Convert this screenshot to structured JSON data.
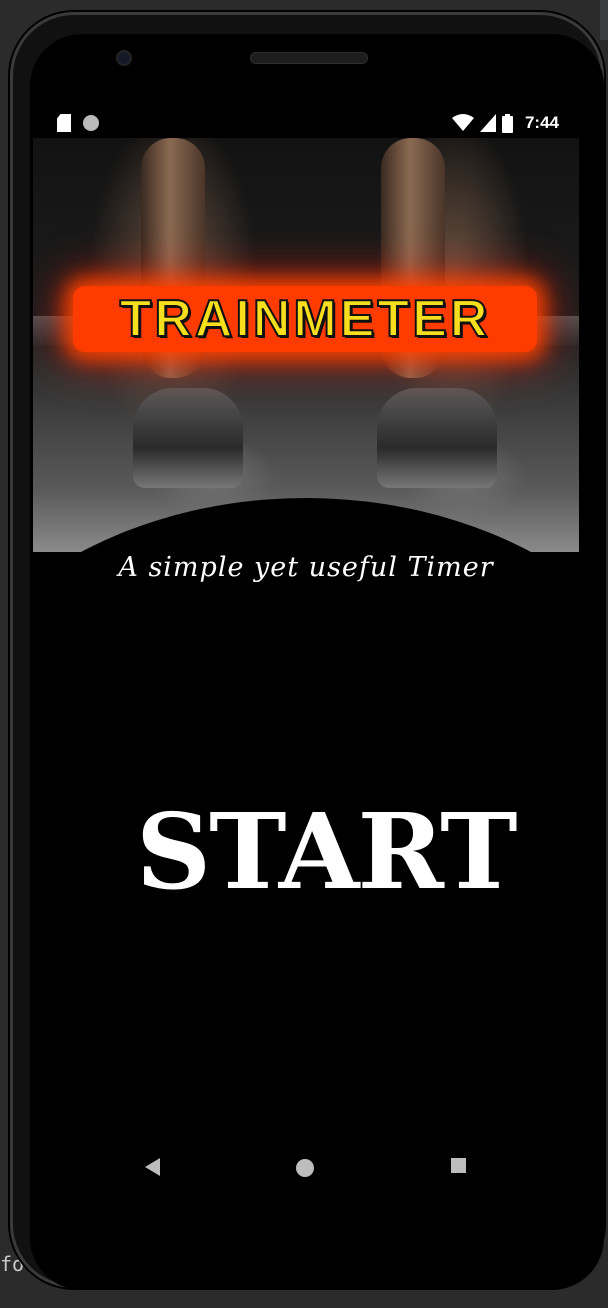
{
  "ide": {
    "bottom_left_text": "fo"
  },
  "status_bar": {
    "time": "7:44",
    "left_icons": [
      "sd-card-icon",
      "notification-dot-icon"
    ],
    "right_icons": [
      "wifi-icon",
      "signal-icon",
      "battery-icon"
    ]
  },
  "hero": {
    "title": "TRAINMETER",
    "title_color": "#f7df1e",
    "title_glow_color": "#ff3b00"
  },
  "main": {
    "tagline": "A simple yet useful Timer",
    "start_label": "START"
  },
  "nav_bar": {
    "icons": [
      "back-triangle-icon",
      "home-circle-icon",
      "recents-square-icon"
    ]
  },
  "colors": {
    "background": "#000000",
    "text": "#ffffff"
  }
}
